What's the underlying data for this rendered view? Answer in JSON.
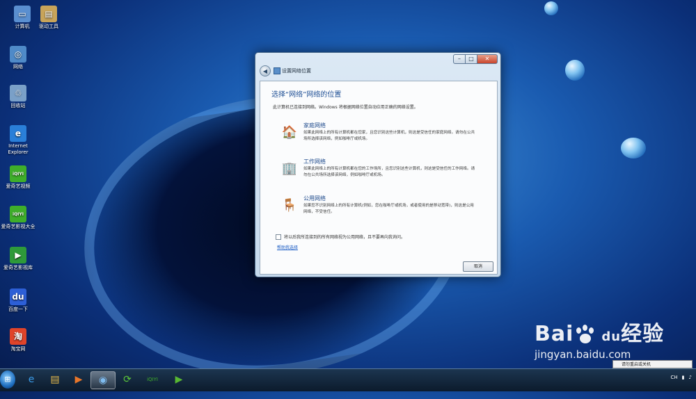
{
  "desktop": {
    "icons": [
      {
        "label": "计算机",
        "glyph": "▭",
        "color": "#5a8fd0"
      },
      {
        "label": "驱动工具",
        "glyph": "▤",
        "color": "#c8a45a"
      },
      {
        "label": "网络",
        "glyph": "◎",
        "color": "#4f8ac8"
      },
      {
        "label": "回收站",
        "glyph": "♲",
        "color": "#7aa0c8"
      },
      {
        "label": "Internet Explorer",
        "glyph": "e",
        "color": "#2a7fd8"
      },
      {
        "label": "爱奇艺视频",
        "glyph": "iQIYI",
        "color": "#3fae2a"
      },
      {
        "label": "爱奇艺影视大全",
        "glyph": "iQIYI",
        "color": "#3fae2a"
      },
      {
        "label": "爱奇艺影视库",
        "glyph": "▶",
        "color": "#2e9a3a"
      },
      {
        "label": "百度一下",
        "glyph": "du",
        "color": "#2d5fd6"
      },
      {
        "label": "淘宝网",
        "glyph": "淘",
        "color": "#e0442a"
      }
    ]
  },
  "dialog": {
    "title": "设置网络位置",
    "heading": "选择“网络”网络的位置",
    "description": "此计算机已连接到网络。Windows 将根据网络位置自动应用正确的网络设置。",
    "options": [
      {
        "title": "家庭网络",
        "text": "如果此网络上的所有计算机都在您家，且您识别这些计算机，则这是受信任的家庭网络。请勿在公共场所选择该网络，例如咖啡厅或机场。",
        "icon": "house-icon"
      },
      {
        "title": "工作网络",
        "text": "如果此网络上的所有计算机都在您的工作场所，且您识别这些计算机，则这是受信任的工作网络。请勿在公共场所选择该网络，例如咖啡厅或机场。",
        "icon": "office-building-icon"
      },
      {
        "title": "公用网络",
        "text": "如果您不识别网络上的所有计算机(例如，您在咖啡厅或机场，或者使用的是移动宽带)，则这是公用网络，不受信任。",
        "icon": "park-bench-icon"
      }
    ],
    "checkbox_label": "将以后我所连接到的所有网络视为公用网络，且不要再向我询问。",
    "help_link": "帮助我选择",
    "cancel_label": "取消"
  },
  "taskbar": {
    "start_glyph": "⊞",
    "buttons": [
      {
        "glyph": "e",
        "color": "#3a9be8"
      },
      {
        "glyph": "▤",
        "color": "#e6b94a"
      },
      {
        "glyph": "▶",
        "color": "#e8762a"
      },
      {
        "glyph": "◉",
        "color": "#7fbcf0"
      },
      {
        "glyph": "⟳",
        "color": "#5cc83a"
      },
      {
        "glyph": "iQIYI",
        "color": "#3fae2a"
      },
      {
        "glyph": "▶",
        "color": "#58b832"
      }
    ],
    "tray_text": "CH",
    "notification": "请勿重启或关机"
  },
  "watermark": {
    "logo_text": "Bai",
    "logo_text_2": "经验",
    "logo_mid": "du",
    "url": "jingyan.baidu.com"
  }
}
